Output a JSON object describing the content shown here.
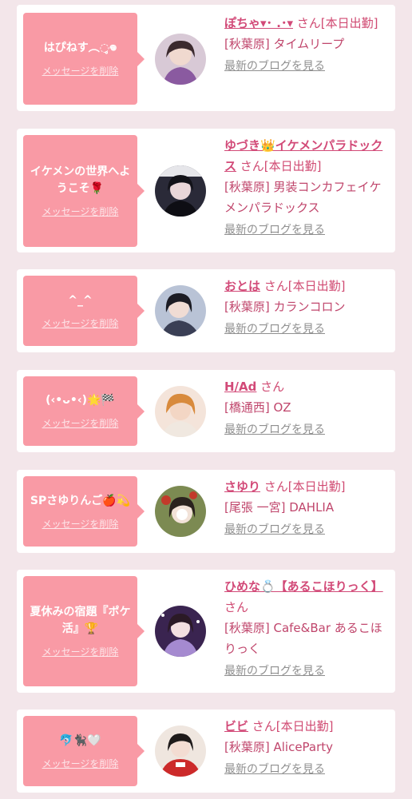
{
  "colors": {
    "background": "#f3e6ea",
    "bubble": "#f99aa5",
    "name": "#d24a78",
    "link_gray": "#8f8f8f"
  },
  "delete_label": "メッセージを削除",
  "blog_label": "最新のブログを見る",
  "items": [
    {
      "message": "はぴねす︵◌̥̥𖦹",
      "name": "ぽちゃ▾･ .･▾",
      "san": "さん[本日出勤]",
      "shop": "[秋葉原] タイムリープ"
    },
    {
      "message": "イケメンの世界へようこそ🌹",
      "name": "ゆづき👑イケメンパラドックス",
      "san": "さん[本日出勤]",
      "shop": "[秋葉原] 男装コンカフェイケメンパラドックス"
    },
    {
      "message": "^_^",
      "name": "おとは",
      "san": "さん[本日出勤]",
      "shop": "[秋葉原] カランコロン"
    },
    {
      "message": "(‹•ᴗ•‹)🌟🏁",
      "name": "H/Ad",
      "san": "さん",
      "shop": "[橋通西] OZ"
    },
    {
      "message": "SPさゆりんご🍎💫",
      "name": "さゆり",
      "san": "さん[本日出勤]",
      "shop": "[尾張 一宮] DAHLIA"
    },
    {
      "message": "夏休みの宿題『ポケ活』🏆",
      "name": "ひめな💍【あるこほりっく】",
      "san": "さん",
      "shop": "[秋葉原] Cafe&Bar あるこほりっく"
    },
    {
      "message": "🐬🐈‍⬛🤍",
      "name": "ビビ",
      "san": "さん[本日出勤]",
      "shop": "[秋葉原] AliceParty"
    }
  ]
}
